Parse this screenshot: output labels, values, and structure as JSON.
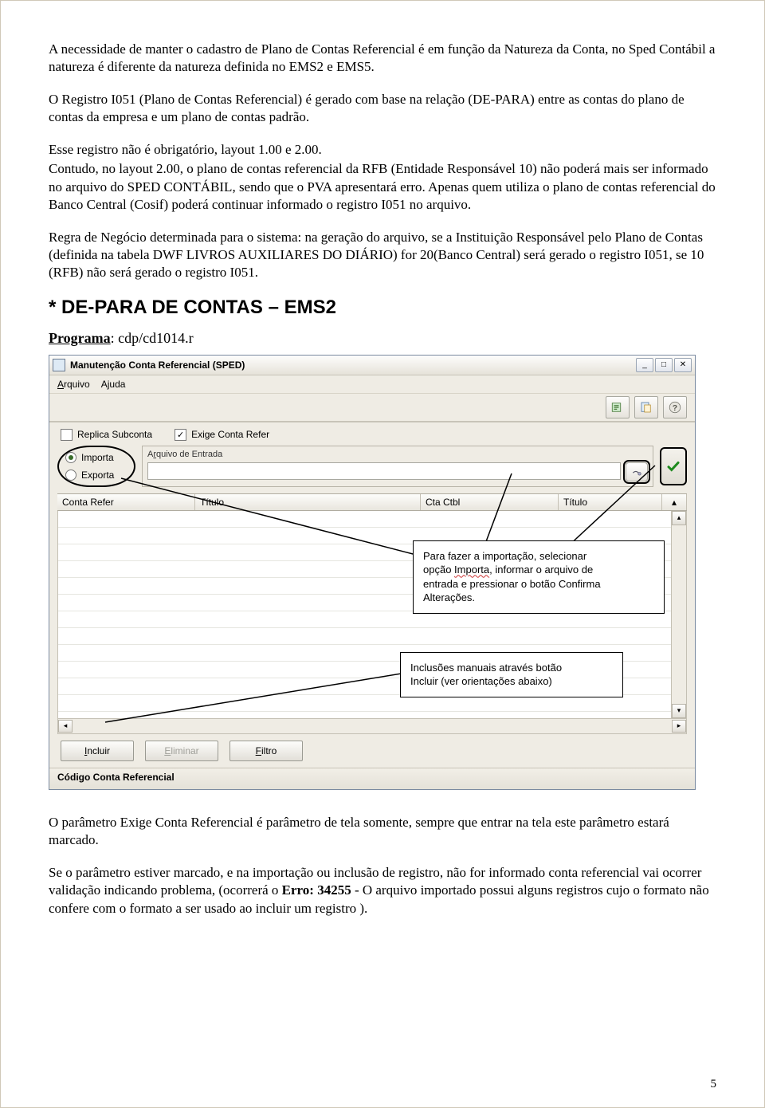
{
  "para1": "A necessidade de manter o cadastro de Plano de Contas Referencial é em função da Natureza da Conta, no Sped Contábil a natureza é diferente da natureza definida no EMS2 e EMS5.",
  "para2": "O Registro I051 (Plano de Contas Referencial) é gerado com base na relação (DE-PARA) entre as contas do plano de contas da empresa e um plano de contas padrão.",
  "para3": "Esse registro não é obrigatório, layout 1.00 e 2.00.",
  "para4": "Contudo, no layout 2.00, o plano de contas referencial da RFB (Entidade Responsável 10) não poderá mais ser informado no arquivo do SPED CONTÁBIL, sendo  que o PVA apresentará erro. Apenas quem utiliza o plano de contas referencial do Banco Central (Cosif) poderá continuar informado o registro I051 no arquivo.",
  "para5": "Regra de Negócio determinada para o sistema: na geração do arquivo, se a Instituição Responsável pelo Plano de Contas (definida na tabela DWF LIVROS AUXILIARES DO DIÁRIO) for 20(Banco Central) será gerado o registro I051, se 10 (RFB) não será gerado o registro I051.",
  "heading": "* DE-PARA DE CONTAS – EMS2",
  "programLabel": "Programa",
  "programValue": ": cdp/cd1014.r",
  "window": {
    "title": "Manutenção Conta Referencial (SPED)",
    "menu": {
      "arquivo": "Arquivo",
      "ajuda": "Ajuda"
    },
    "checkReplica": "Replica Subconta",
    "checkExige": "Exige Conta Refer",
    "radioImporta": "Importa",
    "radioExporta": "Exporta",
    "fileLabel": "Arquivo de Entrada",
    "fileValue": "",
    "cols": {
      "c1": "Conta Refer",
      "c2": "Título",
      "c3": "Cta Ctbl",
      "c4": "Título"
    },
    "btnIncluir": "Incluir",
    "btnEliminar": "Eliminar",
    "btnFiltro": "Filtro",
    "status": "Código Conta Referencial"
  },
  "callout1": {
    "l1": "Para fazer a importação, selecionar",
    "l2a": "opção ",
    "l2b": "Importa",
    "l2c": ", informar o arquivo de",
    "l3": "entrada e pressionar o botão Confirma",
    "l4": "Alterações."
  },
  "callout2": {
    "l1": "Inclusões manuais através botão",
    "l2": "Incluir (ver orientações abaixo)"
  },
  "para6": "O parâmetro Exige Conta Referencial é parâmetro de tela somente, sempre que entrar na tela este parâmetro estará marcado.",
  "para7a": "Se o parâmetro estiver marcado, e na importação ou inclusão de registro, não for informado conta referencial vai ocorrer validação indicando problema, (ocorrerá o ",
  "para7b": "Erro: 34255",
  "para7c": " -  O arquivo importado possui alguns registros cujo o formato  não confere com o formato a ser usado ao incluir um registro ).",
  "pageNumber": "5"
}
